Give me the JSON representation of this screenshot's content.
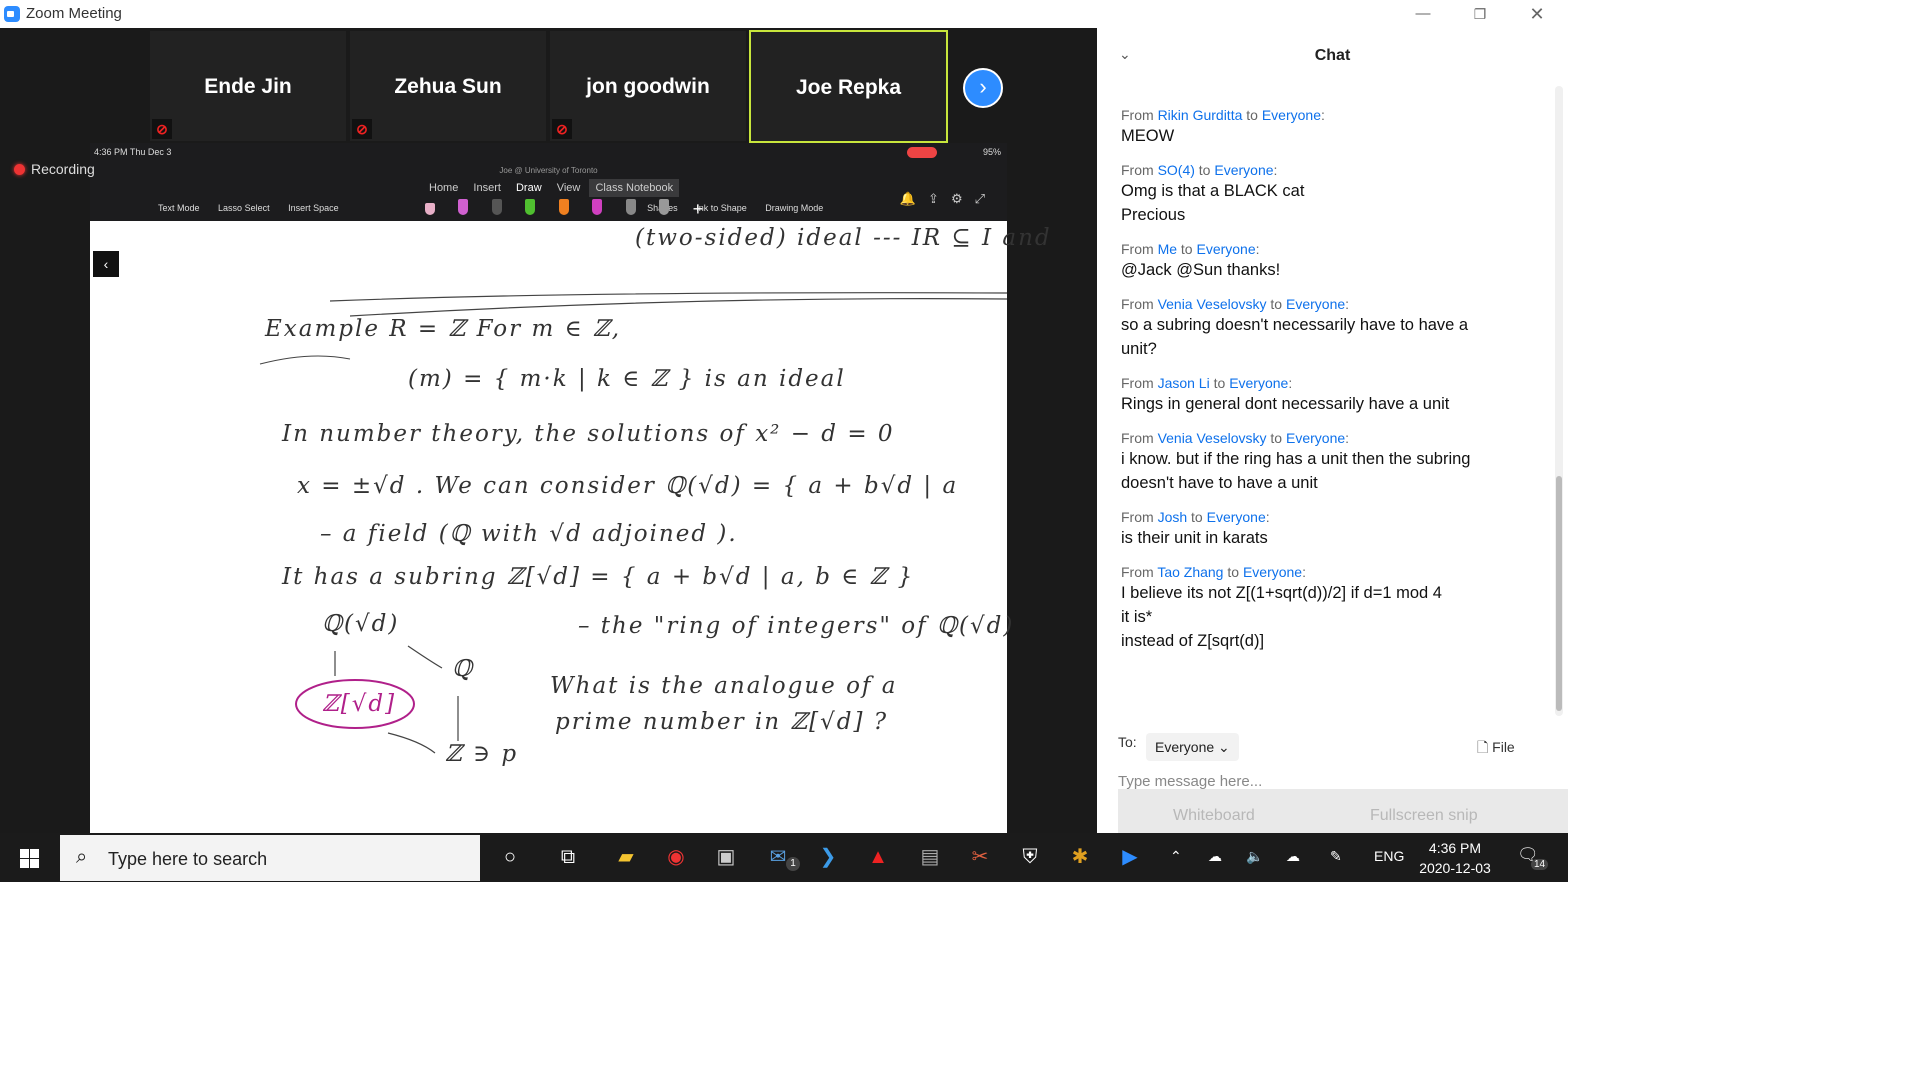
{
  "window": {
    "title": "Zoom Meeting"
  },
  "participants": [
    {
      "name": "Ende Jin",
      "muted": true
    },
    {
      "name": "Zehua Sun",
      "muted": true
    },
    {
      "name": "jon goodwin",
      "muted": true
    },
    {
      "name": "Joe Repka",
      "muted": false,
      "active_speaker": true
    }
  ],
  "recording_label": "Recording",
  "shared_screen": {
    "status_time": "4:36 PM   Thu Dec 3",
    "battery": "95%",
    "account": "Joe @ University of Toronto",
    "tabs": [
      "Home",
      "Insert",
      "Draw",
      "View",
      "Class Notebook"
    ],
    "selected_tab": "Draw",
    "tools": [
      "Text Mode",
      "Lasso Select",
      "Insert Space",
      "Shapes",
      "Ink to Shape",
      "Drawing Mode"
    ],
    "handwriting": [
      "(two-sided) ideal  ---  IR ⊆ I  and",
      "Example   R = ℤ          For  m ∈ ℤ,",
      "(m) = { m·k | k ∈ ℤ }   is  an  ideal",
      "In number theory,  the  solutions  of   x² − d = 0",
      "x = ±√d .   We  can  consider   ℚ(√d) = { a + b√d | a",
      "– a field  (ℚ  with  √d  adjoined ).",
      "It  has  a  subring      ℤ[√d] = { a + b√d | a, b ∈ ℤ }",
      "ℚ(√d)",
      "– the  \"ring of integers\" of  ℚ(√d)",
      "ℚ",
      "What  is  the  analogue  of  a",
      "ℤ[√d]",
      "prime  number  in   ℤ[√d] ?",
      "ℤ  ∋ p"
    ]
  },
  "chat": {
    "title": "Chat",
    "messages": [
      {
        "from": "Rikin Gurditta",
        "to": "Everyone",
        "lines": [
          "MEOW"
        ]
      },
      {
        "from": "SO(4)",
        "to": "Everyone",
        "lines": [
          "Omg is that a BLACK cat",
          "Precious"
        ]
      },
      {
        "from": "Me",
        "to": "Everyone",
        "lines": [
          "@Jack @Sun thanks!"
        ]
      },
      {
        "from": "Venia Veselovsky",
        "to": "Everyone",
        "lines": [
          "so a subring doesn't necessarily have to have a",
          "unit?"
        ]
      },
      {
        "from": "Jason Li",
        "to": "Everyone",
        "lines": [
          "Rings in general dont necessarily have a unit"
        ]
      },
      {
        "from": "Venia Veselovsky",
        "to": "Everyone",
        "lines": [
          "i know. but if the ring has a unit then the subring",
          "doesn't have to have a unit"
        ]
      },
      {
        "from": "Josh",
        "to": "Everyone",
        "lines": [
          "is their unit in karats"
        ]
      },
      {
        "from": "Tao Zhang",
        "to": "Everyone",
        "lines": [
          "I believe its not Z[(1+sqrt(d))/2] if d=1 mod 4",
          "it is*",
          "instead of Z[sqrt(d)]"
        ]
      }
    ],
    "from_word": "From",
    "to_word": "to",
    "to_label": "To:",
    "recipient": "Everyone",
    "file_label": "File",
    "input_placeholder": "Type message here...",
    "overlay_items": [
      "Whiteboard",
      "Fullscreen snip"
    ]
  },
  "taskbar": {
    "search_placeholder": "Type here to search",
    "language": "ENG",
    "time": "4:36 PM",
    "date": "2020-12-03",
    "notification_count": "14",
    "mail_badge": "1"
  }
}
